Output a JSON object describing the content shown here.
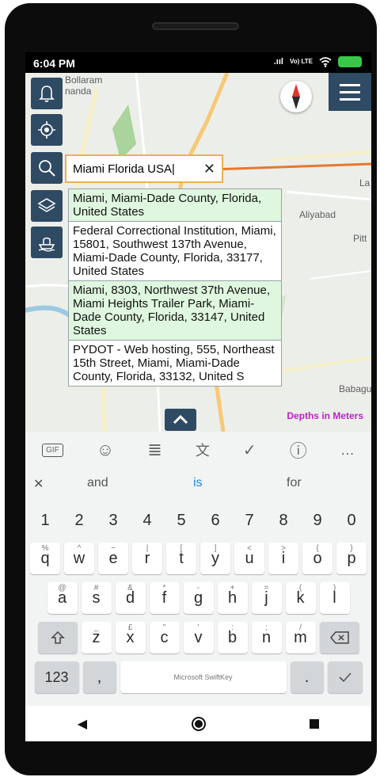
{
  "status": {
    "time": "6:04 PM",
    "volte": "Vo) LTE"
  },
  "map": {
    "labels": {
      "bollaram": "Bollaram",
      "nanda": "nanda",
      "aliyabad": "Aliyabad",
      "pitt": "Pitt",
      "babagu": "Babagu",
      "la": "La"
    },
    "depths": "Depths in Meters"
  },
  "search": {
    "value": "Miami Florida USA|",
    "clear": "✕"
  },
  "results": [
    {
      "text": "Miami, Miami-Dade County, Florida, United States",
      "style": "green"
    },
    {
      "text": "Federal Correctional Institution, Miami, 15801, Southwest 137th Avenue, Miami-Dade County, Florida, 33177, United States",
      "style": "white"
    },
    {
      "text": "Miami, 8303, Northwest 37th Avenue, Miami Heights Trailer Park, Miami-Dade County, Florida, 33147, United States",
      "style": "green"
    },
    {
      "text": "PYDOT - Web hosting, 555, Northeast 15th Street, Miami, Miami-Dade County, Florida, 33132, United S",
      "style": "white"
    }
  ],
  "keyboard": {
    "toolbar": [
      "GIF",
      "☺",
      "≣",
      "文",
      "✓",
      "ⓘ",
      "…"
    ],
    "suggestions": [
      "and",
      "is",
      "for"
    ],
    "numbers": [
      "1",
      "2",
      "3",
      "4",
      "5",
      "6",
      "7",
      "8",
      "9",
      "0"
    ],
    "row1": [
      {
        "k": "q",
        "h": "%"
      },
      {
        "k": "w",
        "h": "^"
      },
      {
        "k": "e",
        "h": "~"
      },
      {
        "k": "r",
        "h": "|"
      },
      {
        "k": "t",
        "h": "["
      },
      {
        "k": "y",
        "h": "]"
      },
      {
        "k": "u",
        "h": "<"
      },
      {
        "k": "i",
        "h": ">"
      },
      {
        "k": "o",
        "h": "{"
      },
      {
        "k": "p",
        "h": "}"
      }
    ],
    "row2": [
      {
        "k": "a",
        "h": "@"
      },
      {
        "k": "s",
        "h": "#"
      },
      {
        "k": "d",
        "h": "&"
      },
      {
        "k": "f",
        "h": "*"
      },
      {
        "k": "g",
        "h": "-"
      },
      {
        "k": "h",
        "h": "+"
      },
      {
        "k": "j",
        "h": "="
      },
      {
        "k": "k",
        "h": "("
      },
      {
        "k": "l",
        "h": ")"
      }
    ],
    "row3": [
      {
        "k": "z",
        "h": "_"
      },
      {
        "k": "x",
        "h": "£"
      },
      {
        "k": "c",
        "h": "\""
      },
      {
        "k": "v",
        "h": "'"
      },
      {
        "k": "b",
        "h": ":"
      },
      {
        "k": "n",
        "h": ";"
      },
      {
        "k": "m",
        "h": "/"
      }
    ],
    "num_key": "123",
    "space_label": "Microsoft SwiftKey",
    "comma": ",",
    "period": "."
  }
}
